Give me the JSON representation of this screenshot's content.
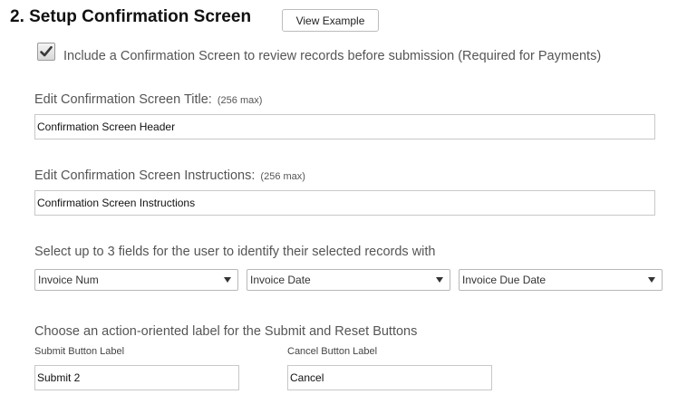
{
  "section": {
    "title": "2. Setup Confirmation Screen",
    "view_example_label": "View Example"
  },
  "include_confirmation": {
    "checked": true,
    "label": "Include a Confirmation Screen to review records before submission (Required for Payments)"
  },
  "title_field": {
    "label": "Edit Confirmation Screen Title:",
    "max_note": "(256 max)",
    "value": "Confirmation Screen Header"
  },
  "instructions_field": {
    "label": "Edit Confirmation Screen Instructions:",
    "max_note": "(256 max)",
    "value": "Confirmation Screen Instructions"
  },
  "identify_fields": {
    "label": "Select up to 3 fields for the user to identify their selected records with",
    "selects": [
      {
        "value": "Invoice Num"
      },
      {
        "value": "Invoice Date"
      },
      {
        "value": "Invoice Due Date"
      }
    ]
  },
  "button_labels": {
    "heading": "Choose an action-oriented label for the Submit and Reset Buttons",
    "submit_label": "Submit Button Label",
    "submit_value": "Submit 2",
    "cancel_label": "Cancel Button Label",
    "cancel_value": "Cancel"
  },
  "icons": {
    "checkbox": "checkmark-icon",
    "select_arrow": "caret-down-icon"
  }
}
